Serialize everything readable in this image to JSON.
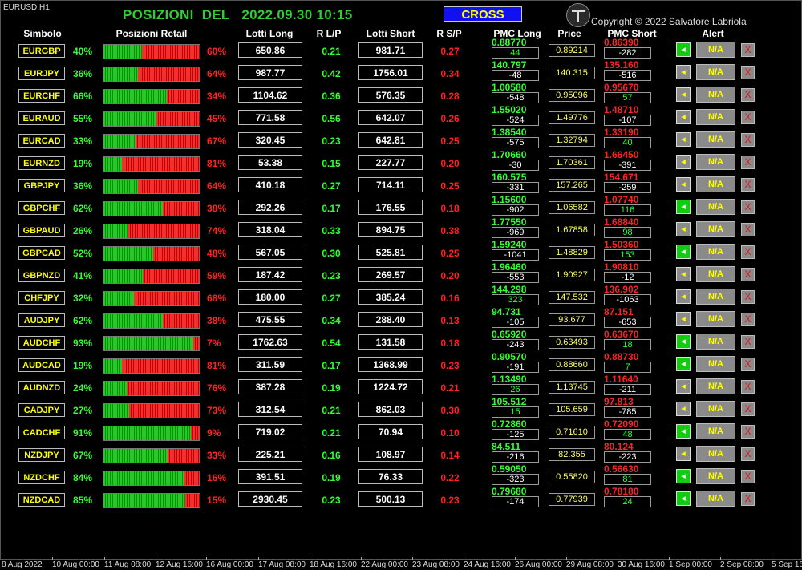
{
  "chart_label": "EURUSD,H1",
  "title": "POSIZIONI  DEL   2022.09.30 10:15",
  "cross_label": "CROSS",
  "copyright": "Copyright © 2022 Salvatore Labriola",
  "headers": {
    "symbol": "Simbolo",
    "retail": "Posizioni Retail",
    "lots_long": "Lotti Long",
    "rlp": "R L/P",
    "lots_short": "Lotti Short",
    "rsp": "R S/P",
    "pmc_long": "PMC Long",
    "price": "Price",
    "pmc_short": "PMC Short",
    "alert": "Alert"
  },
  "alert_text": "N/A",
  "alert_icon_glyph": "◂",
  "delete_glyph": "X",
  "colors": {
    "green": "#33ff33",
    "red": "#ff2222",
    "yellow": "#ffff00"
  },
  "rows": [
    {
      "symbol": "EURGBP",
      "long_pct": "40%",
      "long_frac": 0.4,
      "short_pct": "60%",
      "lots_long": "650.86",
      "rlp": "0.21",
      "lots_short": "981.71",
      "rsp": "0.27",
      "pmc_long": "0.88770",
      "pmc_long_diff": "44",
      "price": "0.89214",
      "pmc_short": "0.86390",
      "pmc_short_diff": "-282",
      "alert_on": true
    },
    {
      "symbol": "EURJPY",
      "long_pct": "36%",
      "long_frac": 0.36,
      "short_pct": "64%",
      "lots_long": "987.77",
      "rlp": "0.42",
      "lots_short": "1756.01",
      "rsp": "0.34",
      "pmc_long": "140.797",
      "pmc_long_diff": "-48",
      "price": "140.315",
      "pmc_short": "135.160",
      "pmc_short_diff": "-516",
      "alert_on": false
    },
    {
      "symbol": "EURCHF",
      "long_pct": "66%",
      "long_frac": 0.66,
      "short_pct": "34%",
      "lots_long": "1104.62",
      "rlp": "0.36",
      "lots_short": "576.35",
      "rsp": "0.28",
      "pmc_long": "1.00580",
      "pmc_long_diff": "-548",
      "price": "0.95096",
      "pmc_short": "0.95670",
      "pmc_short_diff": "57",
      "alert_on": false
    },
    {
      "symbol": "EURAUD",
      "long_pct": "55%",
      "long_frac": 0.55,
      "short_pct": "45%",
      "lots_long": "771.58",
      "rlp": "0.56",
      "lots_short": "642.07",
      "rsp": "0.26",
      "pmc_long": "1.55020",
      "pmc_long_diff": "-524",
      "price": "1.49776",
      "pmc_short": "1.48710",
      "pmc_short_diff": "-107",
      "alert_on": false
    },
    {
      "symbol": "EURCAD",
      "long_pct": "33%",
      "long_frac": 0.33,
      "short_pct": "67%",
      "lots_long": "320.45",
      "rlp": "0.23",
      "lots_short": "642.81",
      "rsp": "0.25",
      "pmc_long": "1.38540",
      "pmc_long_diff": "-575",
      "price": "1.32794",
      "pmc_short": "1.33190",
      "pmc_short_diff": "40",
      "alert_on": false
    },
    {
      "symbol": "EURNZD",
      "long_pct": "19%",
      "long_frac": 0.19,
      "short_pct": "81%",
      "lots_long": "53.38",
      "rlp": "0.15",
      "lots_short": "227.77",
      "rsp": "0.20",
      "pmc_long": "1.70660",
      "pmc_long_diff": "-30",
      "price": "1.70361",
      "pmc_short": "1.66450",
      "pmc_short_diff": "-391",
      "alert_on": false
    },
    {
      "symbol": "GBPJPY",
      "long_pct": "36%",
      "long_frac": 0.36,
      "short_pct": "64%",
      "lots_long": "410.18",
      "rlp": "0.27",
      "lots_short": "714.11",
      "rsp": "0.25",
      "pmc_long": "160.575",
      "pmc_long_diff": "-331",
      "price": "157.265",
      "pmc_short": "154.671",
      "pmc_short_diff": "-259",
      "alert_on": false
    },
    {
      "symbol": "GBPCHF",
      "long_pct": "62%",
      "long_frac": 0.62,
      "short_pct": "38%",
      "lots_long": "292.26",
      "rlp": "0.17",
      "lots_short": "176.55",
      "rsp": "0.18",
      "pmc_long": "1.15600",
      "pmc_long_diff": "-902",
      "price": "1.06582",
      "pmc_short": "1.07740",
      "pmc_short_diff": "116",
      "alert_on": true
    },
    {
      "symbol": "GBPAUD",
      "long_pct": "26%",
      "long_frac": 0.26,
      "short_pct": "74%",
      "lots_long": "318.04",
      "rlp": "0.33",
      "lots_short": "894.75",
      "rsp": "0.38",
      "pmc_long": "1.77550",
      "pmc_long_diff": "-969",
      "price": "1.67858",
      "pmc_short": "1.68840",
      "pmc_short_diff": "98",
      "alert_on": false
    },
    {
      "symbol": "GBPCAD",
      "long_pct": "52%",
      "long_frac": 0.52,
      "short_pct": "48%",
      "lots_long": "567.05",
      "rlp": "0.30",
      "lots_short": "525.81",
      "rsp": "0.25",
      "pmc_long": "1.59240",
      "pmc_long_diff": "-1041",
      "price": "1.48829",
      "pmc_short": "1.50360",
      "pmc_short_diff": "153",
      "alert_on": true
    },
    {
      "symbol": "GBPNZD",
      "long_pct": "41%",
      "long_frac": 0.41,
      "short_pct": "59%",
      "lots_long": "187.42",
      "rlp": "0.23",
      "lots_short": "269.57",
      "rsp": "0.20",
      "pmc_long": "1.96460",
      "pmc_long_diff": "-553",
      "price": "1.90927",
      "pmc_short": "1.90810",
      "pmc_short_diff": "-12",
      "alert_on": false
    },
    {
      "symbol": "CHFJPY",
      "long_pct": "32%",
      "long_frac": 0.32,
      "short_pct": "68%",
      "lots_long": "180.00",
      "rlp": "0.27",
      "lots_short": "385.24",
      "rsp": "0.16",
      "pmc_long": "144.298",
      "pmc_long_diff": "323",
      "price": "147.532",
      "pmc_short": "136.902",
      "pmc_short_diff": "-1063",
      "alert_on": false
    },
    {
      "symbol": "AUDJPY",
      "long_pct": "62%",
      "long_frac": 0.62,
      "short_pct": "38%",
      "lots_long": "475.55",
      "rlp": "0.34",
      "lots_short": "288.40",
      "rsp": "0.13",
      "pmc_long": "94.731",
      "pmc_long_diff": "-105",
      "price": "93.677",
      "pmc_short": "87.151",
      "pmc_short_diff": "-653",
      "alert_on": false
    },
    {
      "symbol": "AUDCHF",
      "long_pct": "93%",
      "long_frac": 0.93,
      "short_pct": "7%",
      "lots_long": "1762.63",
      "rlp": "0.54",
      "lots_short": "131.58",
      "rsp": "0.18",
      "pmc_long": "0.65920",
      "pmc_long_diff": "-243",
      "price": "0.63493",
      "pmc_short": "0.63670",
      "pmc_short_diff": "18",
      "alert_on": true
    },
    {
      "symbol": "AUDCAD",
      "long_pct": "19%",
      "long_frac": 0.19,
      "short_pct": "81%",
      "lots_long": "311.59",
      "rlp": "0.17",
      "lots_short": "1368.99",
      "rsp": "0.23",
      "pmc_long": "0.90570",
      "pmc_long_diff": "-191",
      "price": "0.88660",
      "pmc_short": "0.88730",
      "pmc_short_diff": "7",
      "alert_on": true
    },
    {
      "symbol": "AUDNZD",
      "long_pct": "24%",
      "long_frac": 0.24,
      "short_pct": "76%",
      "lots_long": "387.28",
      "rlp": "0.19",
      "lots_short": "1224.72",
      "rsp": "0.21",
      "pmc_long": "1.13490",
      "pmc_long_diff": "26",
      "price": "1.13745",
      "pmc_short": "1.11640",
      "pmc_short_diff": "-211",
      "alert_on": false
    },
    {
      "symbol": "CADJPY",
      "long_pct": "27%",
      "long_frac": 0.27,
      "short_pct": "73%",
      "lots_long": "312.54",
      "rlp": "0.21",
      "lots_short": "862.03",
      "rsp": "0.30",
      "pmc_long": "105.512",
      "pmc_long_diff": "15",
      "price": "105.659",
      "pmc_short": "97.813",
      "pmc_short_diff": "-785",
      "alert_on": false
    },
    {
      "symbol": "CADCHF",
      "long_pct": "91%",
      "long_frac": 0.91,
      "short_pct": "9%",
      "lots_long": "719.02",
      "rlp": "0.21",
      "lots_short": "70.94",
      "rsp": "0.10",
      "pmc_long": "0.72860",
      "pmc_long_diff": "-125",
      "price": "0.71610",
      "pmc_short": "0.72090",
      "pmc_short_diff": "48",
      "alert_on": true
    },
    {
      "symbol": "NZDJPY",
      "long_pct": "67%",
      "long_frac": 0.67,
      "short_pct": "33%",
      "lots_long": "225.21",
      "rlp": "0.16",
      "lots_short": "108.97",
      "rsp": "0.14",
      "pmc_long": "84.511",
      "pmc_long_diff": "-216",
      "price": "82.355",
      "pmc_short": "80.124",
      "pmc_short_diff": "-223",
      "alert_on": false
    },
    {
      "symbol": "NZDCHF",
      "long_pct": "84%",
      "long_frac": 0.84,
      "short_pct": "16%",
      "lots_long": "391.51",
      "rlp": "0.19",
      "lots_short": "76.33",
      "rsp": "0.22",
      "pmc_long": "0.59050",
      "pmc_long_diff": "-323",
      "price": "0.55820",
      "pmc_short": "0.56630",
      "pmc_short_diff": "81",
      "alert_on": true
    },
    {
      "symbol": "NZDCAD",
      "long_pct": "85%",
      "long_frac": 0.85,
      "short_pct": "15%",
      "lots_long": "2930.45",
      "rlp": "0.23",
      "lots_short": "500.13",
      "rsp": "0.23",
      "pmc_long": "0.79680",
      "pmc_long_diff": "-174",
      "price": "0.77939",
      "pmc_short": "0.78180",
      "pmc_short_diff": "24",
      "alert_on": true
    }
  ],
  "timeline": [
    "8 Aug 2022",
    "10 Aug 00:00",
    "11 Aug 08:00",
    "12 Aug 16:00",
    "16 Aug 00:00",
    "17 Aug 08:00",
    "18 Aug 16:00",
    "22 Aug 00:00",
    "23 Aug 08:00",
    "24 Aug 16:00",
    "26 Aug 00:00",
    "29 Aug 08:00",
    "30 Aug 16:00",
    "1 Sep 00:00",
    "2 Sep 08:00",
    "5 Sep 16:00"
  ]
}
